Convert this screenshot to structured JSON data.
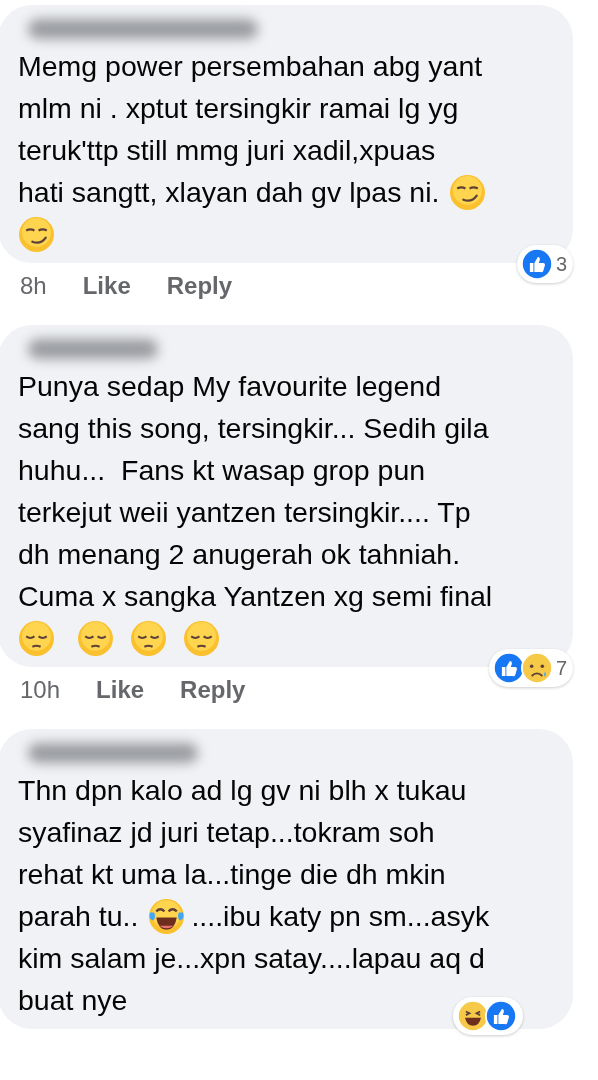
{
  "comments": [
    {
      "lines": [
        [
          {
            "kind": "text",
            "text": "Memg power persembahan abg yant"
          }
        ],
        [
          {
            "kind": "text",
            "text": "mlm ni . xptut tersingkir ramai lg yg"
          }
        ],
        [
          {
            "kind": "text",
            "text": "teruk'ttp still mmg juri xadil,xpuas"
          }
        ],
        [
          {
            "kind": "text",
            "text": "hati sangtt, xlayan dah gv lpas ni."
          },
          {
            "kind": "smirk"
          }
        ],
        [
          {
            "kind": "smirk"
          }
        ]
      ],
      "time": "8h",
      "actions": [
        "Like",
        "Reply"
      ],
      "reactions": [
        {
          "kind": "like"
        }
      ],
      "reaction_count": "3"
    },
    {
      "lines": [
        [
          {
            "kind": "text",
            "text": "Punya sedap My favourite legend"
          }
        ],
        [
          {
            "kind": "text",
            "text": "sang this song, tersingkir... Sedih gila"
          }
        ],
        [
          {
            "kind": "text",
            "text": "huhu...  Fans kt wasap grop pun"
          }
        ],
        [
          {
            "kind": "text",
            "text": "terkejut weii yantzen tersingkir.... Tp"
          }
        ],
        [
          {
            "kind": "text",
            "text": "dh menang 2 anugerah ok tahniah."
          }
        ],
        [
          {
            "kind": "text",
            "text": "Cuma x sangka Yantzen xg semi final"
          }
        ],
        [
          {
            "kind": "pensive"
          },
          {
            "kind": "pensive"
          },
          {
            "kind": "pensive"
          },
          {
            "kind": "pensive"
          }
        ]
      ],
      "time": "10h",
      "actions": [
        "Like",
        "Reply"
      ],
      "reactions": [
        {
          "kind": "like"
        },
        {
          "kind": "sad"
        }
      ],
      "reaction_count": "7"
    },
    {
      "lines": [
        [
          {
            "kind": "text",
            "text": "Thn dpn kalo ad lg gv ni blh x tukau"
          }
        ],
        [
          {
            "kind": "text",
            "text": "syafinaz jd juri tetap...tokram soh"
          }
        ],
        [
          {
            "kind": "text",
            "text": "rehat kt uma la...tinge die dh mkin"
          }
        ],
        [
          {
            "kind": "text",
            "text": "parah tu.."
          },
          {
            "kind": "joy"
          },
          {
            "kind": "text",
            "text": "....ibu katy pn sm...asyk"
          }
        ],
        [
          {
            "kind": "text",
            "text": "kim salam je...xpn satay....lapau aq d"
          }
        ],
        [
          {
            "kind": "text",
            "text": "buat nye"
          }
        ]
      ],
      "reactions": [
        {
          "kind": "haha"
        },
        {
          "kind": "like"
        }
      ]
    }
  ]
}
